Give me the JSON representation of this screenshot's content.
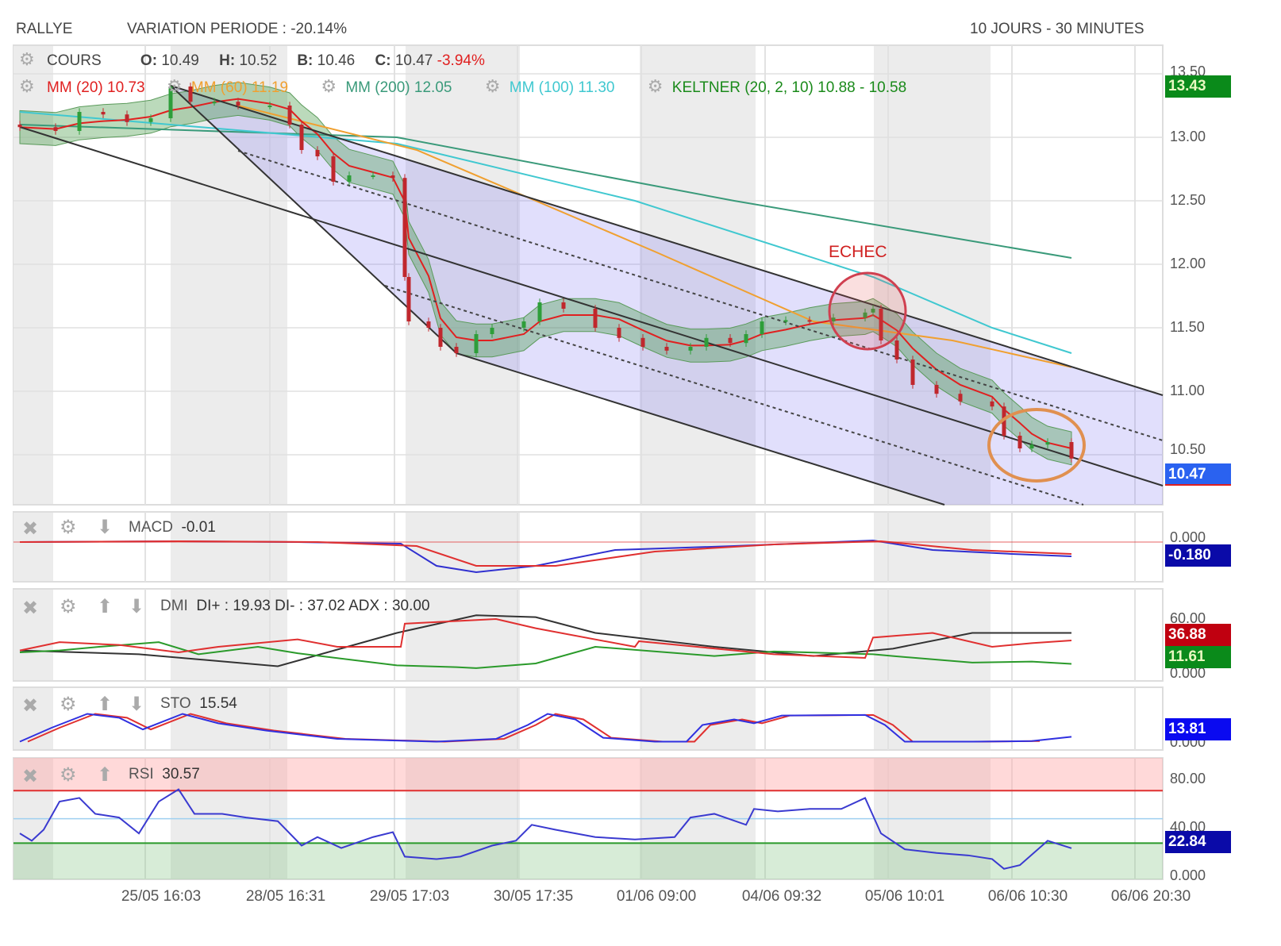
{
  "header": {
    "symbol": "RALLYE",
    "variation": "VARIATION PERIODE : -20.14%",
    "period": "10 JOURS - 30 MINUTES"
  },
  "legend": {
    "cours": "COURS",
    "o_label": "O:",
    "o": "10.49",
    "h_label": "H:",
    "h": "10.52",
    "b_label": "B:",
    "b": "10.46",
    "c_label": "C:",
    "c": "10.47",
    "change": "-3.94%",
    "mm20": "MM (20)",
    "mm20_val": "10.73",
    "mm60": "MM (60)",
    "mm60_val": "11.19",
    "mm200": "MM (200)",
    "mm200_val": "12.05",
    "mm100": "MM (100)",
    "mm100_val": "11.30",
    "keltner": "KELTNER (20, 2, 10)",
    "keltner_val": "10.88 - 10.58"
  },
  "annotation": {
    "echec": "ECHEC"
  },
  "price_axis": [
    "13.50",
    "13.00",
    "12.50",
    "12.00",
    "11.50",
    "11.00",
    "10.50"
  ],
  "price_badges": {
    "high": "13.43",
    "last": "10.47"
  },
  "macd": {
    "label": "MACD",
    "value": "-0.01",
    "axis": "0.000",
    "badge": "-0.180"
  },
  "dmi": {
    "label": "DMI",
    "value": "DI+ : 19.93 DI- : 37.02 ADX : 30.00",
    "axis_top": "60.00",
    "axis_bottom": "0.000",
    "badge_red": "36.88",
    "badge_green": "11.61"
  },
  "sto": {
    "label": "STO",
    "value": "15.54",
    "axis": "0.000",
    "badge": "13.81"
  },
  "rsi": {
    "label": "RSI",
    "value": "30.57",
    "axis": [
      "80.00",
      "40.00",
      "0.000"
    ],
    "badge": "22.84"
  },
  "x_axis": [
    "25/05 16:03",
    "28/05 16:31",
    "29/05 17:03",
    "30/05 17:35",
    "01/06 09:00",
    "04/06 09:32",
    "05/06 10:01",
    "06/06 10:30",
    "06/06 20:30"
  ],
  "colors": {
    "up": "#2e9e3a",
    "down": "#c0272d",
    "mm20": "#e02020",
    "mm60": "#f0a030",
    "mm200": "#3a9a7a",
    "mm100": "#40c8d0",
    "keltner": "#2a8a2a"
  },
  "chart_data": {
    "type": "candlestick",
    "title": "RALLYE 10 JOURS - 30 MINUTES",
    "ylim": [
      10.3,
      13.6
    ],
    "price": [
      [
        0,
        13.08
      ],
      [
        9,
        13.05
      ],
      [
        15,
        13.2
      ],
      [
        21,
        13.18
      ],
      [
        27,
        13.12
      ],
      [
        33,
        13.15
      ],
      [
        38,
        13.4
      ],
      [
        43,
        13.28
      ],
      [
        49,
        13.28
      ],
      [
        55,
        13.25
      ],
      [
        63,
        13.25
      ],
      [
        68,
        13.1
      ],
      [
        71,
        12.9
      ],
      [
        75,
        12.85
      ],
      [
        79,
        12.65
      ],
      [
        83,
        12.7
      ],
      [
        89,
        12.7
      ],
      [
        94,
        12.68
      ],
      [
        97,
        11.9
      ],
      [
        98,
        11.55
      ],
      [
        103,
        11.5
      ],
      [
        106,
        11.35
      ],
      [
        110,
        11.3
      ],
      [
        115,
        11.45
      ],
      [
        119,
        11.5
      ],
      [
        127,
        11.55
      ],
      [
        131,
        11.7
      ],
      [
        137,
        11.65
      ],
      [
        145,
        11.5
      ],
      [
        151,
        11.42
      ],
      [
        157,
        11.35
      ],
      [
        163,
        11.32
      ],
      [
        169,
        11.35
      ],
      [
        173,
        11.42
      ],
      [
        179,
        11.38
      ],
      [
        183,
        11.45
      ],
      [
        187,
        11.55
      ],
      [
        193,
        11.56
      ],
      [
        199,
        11.55
      ],
      [
        205,
        11.58
      ],
      [
        213,
        11.62
      ],
      [
        215,
        11.65
      ],
      [
        217,
        11.4
      ],
      [
        221,
        11.25
      ],
      [
        225,
        11.05
      ],
      [
        231,
        10.98
      ],
      [
        237,
        10.92
      ],
      [
        245,
        10.88
      ],
      [
        248,
        10.65
      ],
      [
        252,
        10.55
      ],
      [
        255,
        10.58
      ],
      [
        259,
        10.6
      ],
      [
        265,
        10.47
      ]
    ],
    "mm60": [
      [
        55,
        13.25
      ],
      [
        100,
        12.9
      ],
      [
        160,
        12.1
      ],
      [
        200,
        11.55
      ],
      [
        235,
        11.4
      ],
      [
        265,
        11.19
      ]
    ],
    "mm100": [
      [
        0,
        13.2
      ],
      [
        95,
        12.95
      ],
      [
        155,
        12.5
      ],
      [
        215,
        11.9
      ],
      [
        245,
        11.5
      ],
      [
        265,
        11.3
      ]
    ],
    "mm200": [
      [
        0,
        13.1
      ],
      [
        95,
        13.0
      ],
      [
        180,
        12.5
      ],
      [
        265,
        12.05
      ]
    ],
    "macd": [
      [
        0,
        0
      ],
      [
        40,
        0.01
      ],
      [
        70,
        0
      ],
      [
        96,
        -0.02
      ],
      [
        105,
        -0.3
      ],
      [
        115,
        -0.38
      ],
      [
        130,
        -0.3
      ],
      [
        150,
        -0.1
      ],
      [
        180,
        -0.05
      ],
      [
        215,
        0.02
      ],
      [
        230,
        -0.1
      ],
      [
        250,
        -0.15
      ],
      [
        265,
        -0.18
      ]
    ],
    "macd_signal": [
      [
        0,
        0
      ],
      [
        40,
        0.01
      ],
      [
        75,
        0
      ],
      [
        100,
        -0.05
      ],
      [
        115,
        -0.3
      ],
      [
        135,
        -0.3
      ],
      [
        160,
        -0.12
      ],
      [
        190,
        -0.03
      ],
      [
        217,
        0.01
      ],
      [
        240,
        -0.1
      ],
      [
        265,
        -0.15
      ]
    ],
    "di_plus": [
      [
        0,
        24
      ],
      [
        10,
        26
      ],
      [
        20,
        30
      ],
      [
        35,
        35
      ],
      [
        45,
        22
      ],
      [
        60,
        30
      ],
      [
        70,
        23
      ],
      [
        95,
        10
      ],
      [
        110,
        8
      ],
      [
        115,
        7
      ],
      [
        130,
        12
      ],
      [
        145,
        30
      ],
      [
        175,
        20
      ],
      [
        190,
        25
      ],
      [
        215,
        22
      ],
      [
        220,
        20
      ],
      [
        240,
        13
      ],
      [
        255,
        14
      ],
      [
        265,
        11.61
      ]
    ],
    "di_minus": [
      [
        0,
        26
      ],
      [
        10,
        35
      ],
      [
        25,
        32
      ],
      [
        40,
        24
      ],
      [
        50,
        30
      ],
      [
        70,
        38
      ],
      [
        80,
        30
      ],
      [
        96,
        30
      ],
      [
        97,
        55
      ],
      [
        120,
        60
      ],
      [
        130,
        50
      ],
      [
        155,
        30
      ],
      [
        156,
        36
      ],
      [
        190,
        22
      ],
      [
        213,
        18
      ],
      [
        215,
        40
      ],
      [
        230,
        45
      ],
      [
        245,
        30
      ],
      [
        255,
        34
      ],
      [
        265,
        36.88
      ]
    ],
    "adx": [
      [
        0,
        26
      ],
      [
        30,
        22
      ],
      [
        65,
        9
      ],
      [
        95,
        45
      ],
      [
        115,
        64
      ],
      [
        130,
        62
      ],
      [
        145,
        45
      ],
      [
        175,
        30
      ],
      [
        200,
        20
      ],
      [
        220,
        28
      ],
      [
        240,
        45
      ],
      [
        265,
        45
      ]
    ],
    "sto_k": [
      [
        0,
        5
      ],
      [
        8,
        30
      ],
      [
        17,
        55
      ],
      [
        25,
        48
      ],
      [
        31,
        27
      ],
      [
        41,
        55
      ],
      [
        50,
        38
      ],
      [
        62,
        25
      ],
      [
        80,
        10
      ],
      [
        105,
        5
      ],
      [
        120,
        10
      ],
      [
        128,
        35
      ],
      [
        133,
        55
      ],
      [
        140,
        45
      ],
      [
        147,
        12
      ],
      [
        160,
        5
      ],
      [
        168,
        5
      ],
      [
        172,
        35
      ],
      [
        180,
        45
      ],
      [
        185,
        38
      ],
      [
        192,
        52
      ],
      [
        213,
        53
      ],
      [
        218,
        35
      ],
      [
        223,
        5
      ],
      [
        240,
        5
      ],
      [
        255,
        6
      ],
      [
        265,
        13.81
      ]
    ],
    "rsi": [
      [
        0,
        35
      ],
      [
        3,
        29
      ],
      [
        6,
        38
      ],
      [
        10,
        61
      ],
      [
        15,
        64
      ],
      [
        19,
        51
      ],
      [
        25,
        48
      ],
      [
        30,
        35
      ],
      [
        35,
        61
      ],
      [
        40,
        71
      ],
      [
        44,
        51
      ],
      [
        51,
        51
      ],
      [
        57,
        48
      ],
      [
        65,
        45
      ],
      [
        71,
        25
      ],
      [
        75,
        32
      ],
      [
        81,
        23
      ],
      [
        89,
        32
      ],
      [
        94,
        36
      ],
      [
        97,
        16
      ],
      [
        105,
        14
      ],
      [
        111,
        16
      ],
      [
        119,
        25
      ],
      [
        125,
        29
      ],
      [
        129,
        42
      ],
      [
        135,
        38
      ],
      [
        145,
        32
      ],
      [
        155,
        30
      ],
      [
        165,
        32
      ],
      [
        169,
        48
      ],
      [
        175,
        51
      ],
      [
        183,
        42
      ],
      [
        185,
        55
      ],
      [
        191,
        53
      ],
      [
        199,
        55
      ],
      [
        207,
        55
      ],
      [
        213,
        64
      ],
      [
        217,
        35
      ],
      [
        223,
        22
      ],
      [
        231,
        19
      ],
      [
        239,
        17
      ],
      [
        245,
        14
      ],
      [
        248,
        6
      ],
      [
        252,
        9
      ],
      [
        259,
        29
      ],
      [
        265,
        22.84
      ]
    ]
  }
}
